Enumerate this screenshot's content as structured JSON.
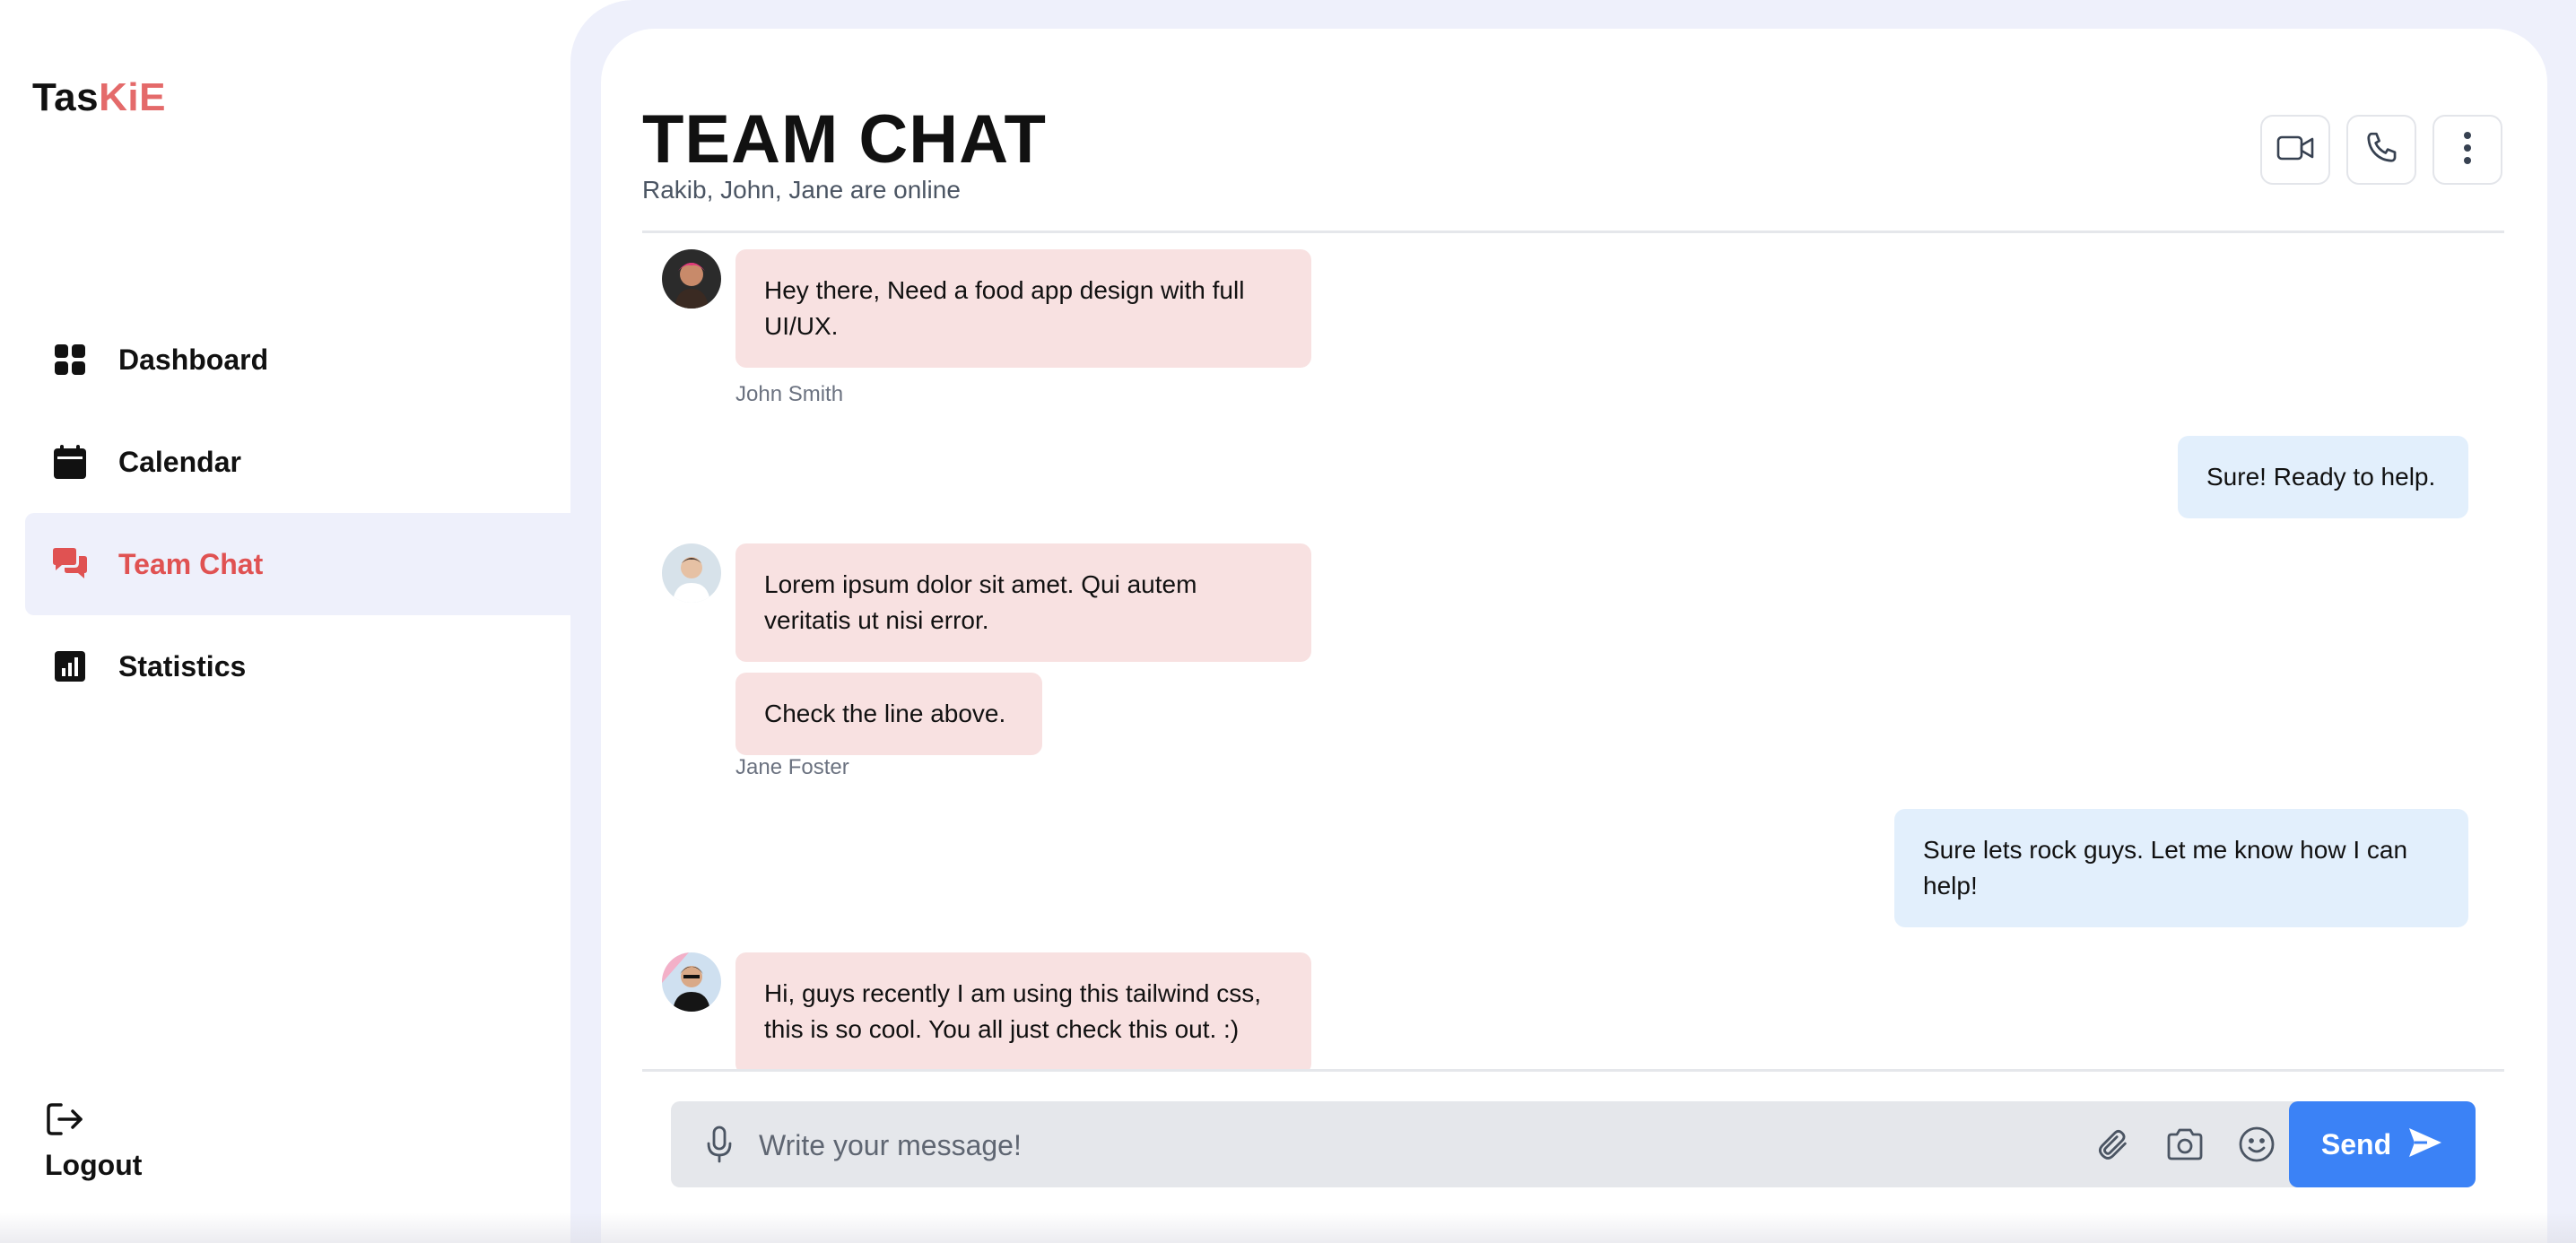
{
  "brand": {
    "part1": "Tas",
    "part2": "KiE"
  },
  "sidebar": {
    "items": [
      {
        "label": "Dashboard",
        "icon": "grid-icon"
      },
      {
        "label": "Calendar",
        "icon": "calendar-icon"
      },
      {
        "label": "Team Chat",
        "icon": "chat-icon",
        "active": true
      },
      {
        "label": "Statistics",
        "icon": "bar-chart-icon"
      }
    ],
    "logout_label": "Logout"
  },
  "chat": {
    "title": "TEAM CHAT",
    "subtitle": "Rakib, John, Jane are online",
    "actions": [
      "video-call-icon",
      "phone-icon",
      "more-vertical-icon"
    ]
  },
  "messages": [
    {
      "text": "Hey there, Need a food app design with full UI/UX.",
      "sender": "John Smith",
      "direction": "in"
    },
    {
      "text": "Sure! Ready to help.",
      "direction": "out"
    },
    {
      "text": "Lorem ipsum dolor sit amet. Qui autem veritatis ut nisi error.",
      "direction": "in"
    },
    {
      "text": "Check the line above.",
      "sender": "Jane Foster",
      "direction": "in"
    },
    {
      "text": "Sure lets rock guys. Let me know how I can help!",
      "direction": "out"
    },
    {
      "text": "Hi, guys recently I am using this tailwind css, this is so cool. You all just check this out. :)",
      "direction": "in"
    }
  ],
  "composer": {
    "placeholder": "Write your message!",
    "value": "",
    "send_label": "Send",
    "tools": [
      "paperclip-icon",
      "camera-icon",
      "emoji-icon"
    ]
  },
  "colors": {
    "accent": "#e46a6a",
    "active_nav_bg": "#eef0fb",
    "incoming_bubble": "#f8e1e1",
    "outgoing_bubble": "#e2effc",
    "send_button": "#3b82f6"
  }
}
